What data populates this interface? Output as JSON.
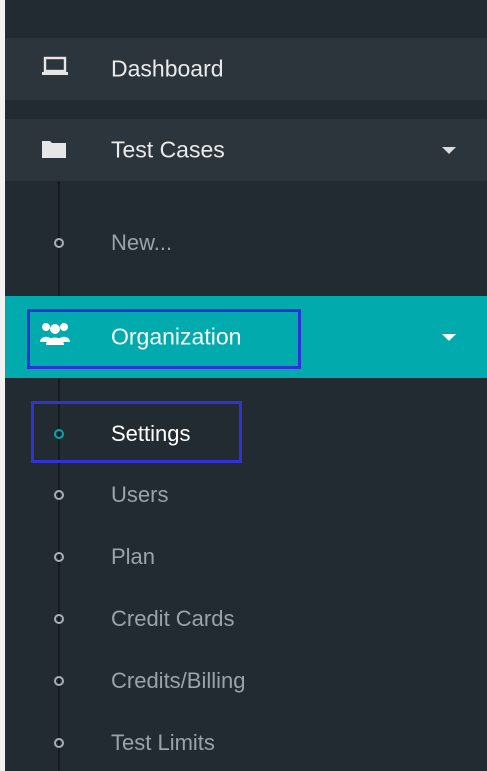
{
  "sidebar": {
    "dashboard": {
      "label": "Dashboard",
      "icon": "laptop-icon"
    },
    "test_cases": {
      "label": "Test Cases",
      "icon": "folder-icon",
      "children": [
        {
          "label": "New..."
        }
      ]
    },
    "organization": {
      "label": "Organization",
      "icon": "users-icon",
      "active": true,
      "children": [
        {
          "label": "Settings",
          "active": true
        },
        {
          "label": "Users"
        },
        {
          "label": "Plan"
        },
        {
          "label": "Credit Cards"
        },
        {
          "label": "Credits/Billing"
        },
        {
          "label": "Test Limits"
        }
      ]
    }
  },
  "colors": {
    "sidebar_bg": "#222b32",
    "top_item_bg": "#2c353c",
    "active_bg": "#00aaad",
    "highlight_box": "#2f33d6",
    "sub_text": "#9aa3a9",
    "active_text": "#ffffff"
  }
}
